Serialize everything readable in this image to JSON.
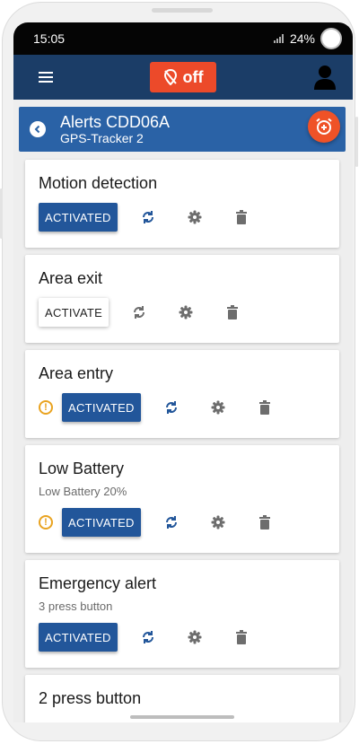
{
  "status_bar": {
    "time": "15:05",
    "battery": "24%"
  },
  "app_bar": {
    "off_label": "off"
  },
  "header": {
    "title": "Alerts CDD06A",
    "subtitle": "GPS-Tracker 2"
  },
  "colors": {
    "app_bar": "#1b3d67",
    "title_bar": "#2a62a6",
    "accent": "#ef5227",
    "activated": "#22569a",
    "refresh_icon": "#22569a",
    "warning": "#e9a320"
  },
  "alerts": [
    {
      "name": "Motion detection",
      "subtitle": "",
      "state": "ACTIVATED",
      "warning": false
    },
    {
      "name": "Area exit",
      "subtitle": "",
      "state": "ACTIVATE",
      "warning": false
    },
    {
      "name": "Area entry",
      "subtitle": "",
      "state": "ACTIVATED",
      "warning": true
    },
    {
      "name": "Low Battery",
      "subtitle": "Low Battery 20%",
      "state": "ACTIVATED",
      "warning": true
    },
    {
      "name": "Emergency alert",
      "subtitle": "3 press button",
      "state": "ACTIVATED",
      "warning": false
    },
    {
      "name": "2 press button",
      "subtitle": "",
      "state": "",
      "warning": false
    }
  ],
  "icons": {
    "menu": "menu-icon",
    "logo": "pin-off-icon",
    "user": "user-icon",
    "back": "chevron-left-icon",
    "add_alarm": "add-alarm-icon",
    "refresh": "refresh-icon",
    "settings": "gear-icon",
    "delete": "trash-icon",
    "warning": "warning-icon"
  }
}
